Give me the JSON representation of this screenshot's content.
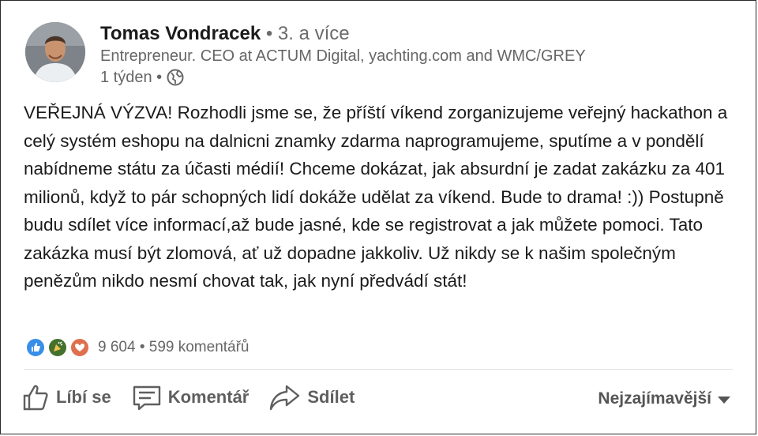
{
  "author": {
    "name": "Tomas Vondracek",
    "degree": " • 3. a více",
    "headline": "Entrepreneur. CEO at ACTUM Digital, yachting.com and WMC/GREY",
    "time": "1 týden •"
  },
  "post": {
    "text": "VEŘEJNÁ VÝZVA! Rozhodli jsme se, že příští víkend zorganizujeme veřejný hackathon a celý systém eshopu na dalnicni znamky zdarma naprogramujeme, sputíme a v pondělí nabídneme státu za účasti médií! Chceme dokázat, jak absurdní je zadat zakázku za 401 milionů, když to pár schopných lidí dokáže udělat za víkend. Bude to drama! :)) Postupně budu sdílet více informací,až bude jasné, kde se registrovat a jak můžete pomoci. Tato zakázka musí být zlomová, ať už dopadne jakkoliv. Už nikdy se k našim společným penězům nikdo nesmí chovat tak, jak nyní předvádí stát!"
  },
  "social": {
    "counts": "9 604 • 599 komentářů",
    "reactions": [
      "like-icon",
      "celebrate-icon",
      "love-icon"
    ]
  },
  "actions": {
    "like": "Líbí se",
    "comment": "Komentář",
    "share": "Sdílet",
    "sort": "Nejzajímavější"
  },
  "colors": {
    "like": "#378fe9",
    "celebrate": "#44712e",
    "love": "#df704d"
  }
}
